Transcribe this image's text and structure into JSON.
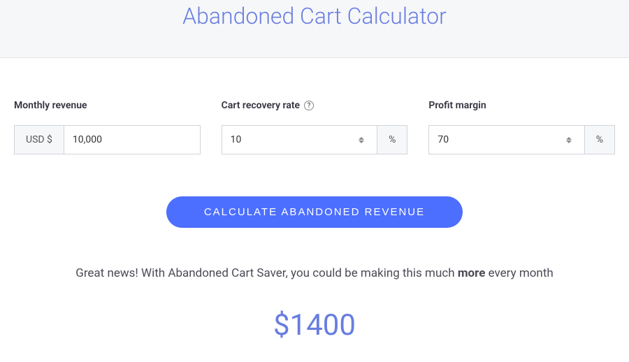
{
  "header": {
    "title": "Abandoned Cart Calculator"
  },
  "fields": {
    "revenue": {
      "label": "Monthly revenue",
      "prefix": "USD $",
      "value": "10,000"
    },
    "recovery": {
      "label": "Cart recovery rate",
      "value": "10",
      "suffix": "%"
    },
    "margin": {
      "label": "Profit margin",
      "value": "70",
      "suffix": "%"
    }
  },
  "button": {
    "label": "CALCULATE ABANDONED REVENUE"
  },
  "result": {
    "msg_before": "Great news! With Abandoned Cart Saver, you could be making this much ",
    "msg_bold": "more",
    "msg_after": " every month",
    "amount": "$1400"
  }
}
